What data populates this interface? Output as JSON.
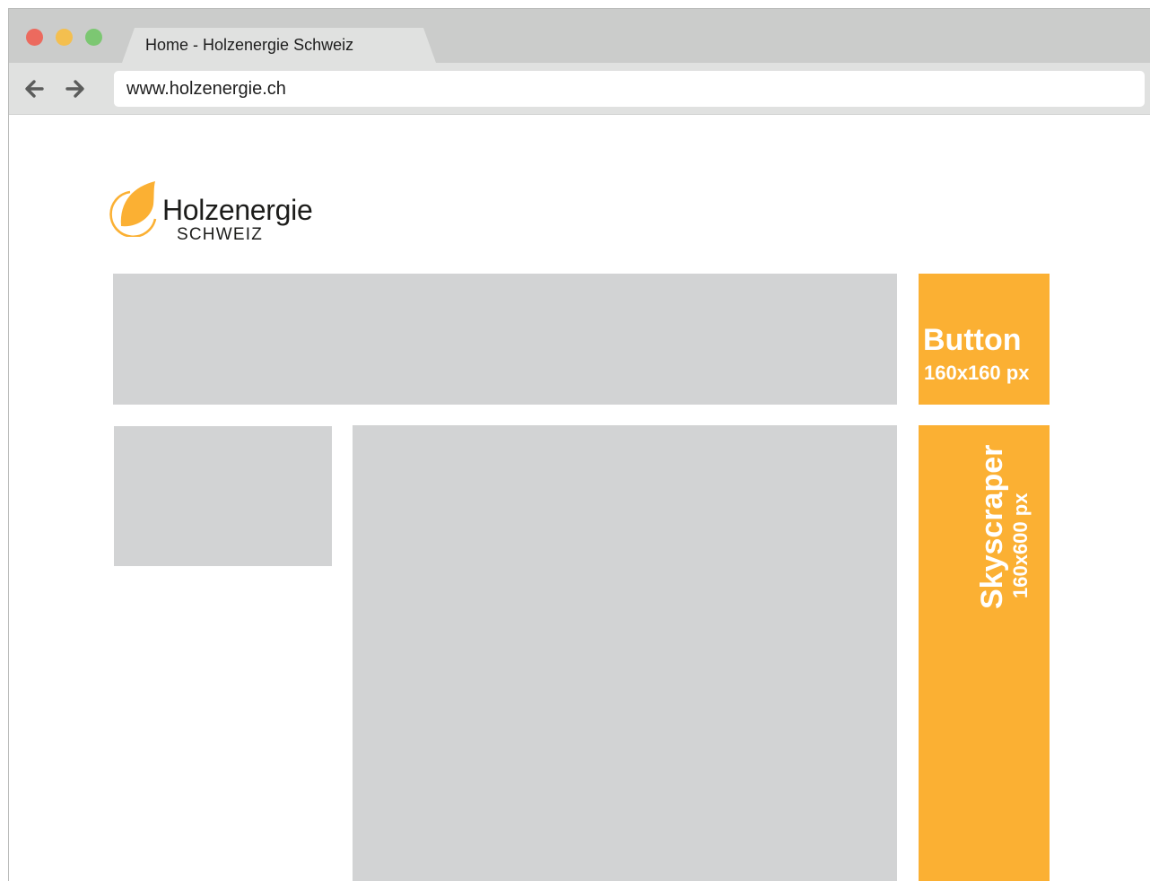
{
  "browser": {
    "tab_title": "Home - Holzenergie Schweiz",
    "url": "www.holzenergie.ch",
    "traffic_colors": [
      "#ec6a5e",
      "#f4bf4f",
      "#62c554"
    ]
  },
  "page": {
    "logo": {
      "name": "Holzenergie",
      "sub": "SCHWEIZ",
      "brand_color": "#fbb033"
    },
    "ads": {
      "button": {
        "label": "Button",
        "size": "160x160 px"
      },
      "skyscraper": {
        "label": "Skyscraper",
        "size": "160x600 px"
      }
    },
    "placeholder_color": "#d2d3d4"
  }
}
